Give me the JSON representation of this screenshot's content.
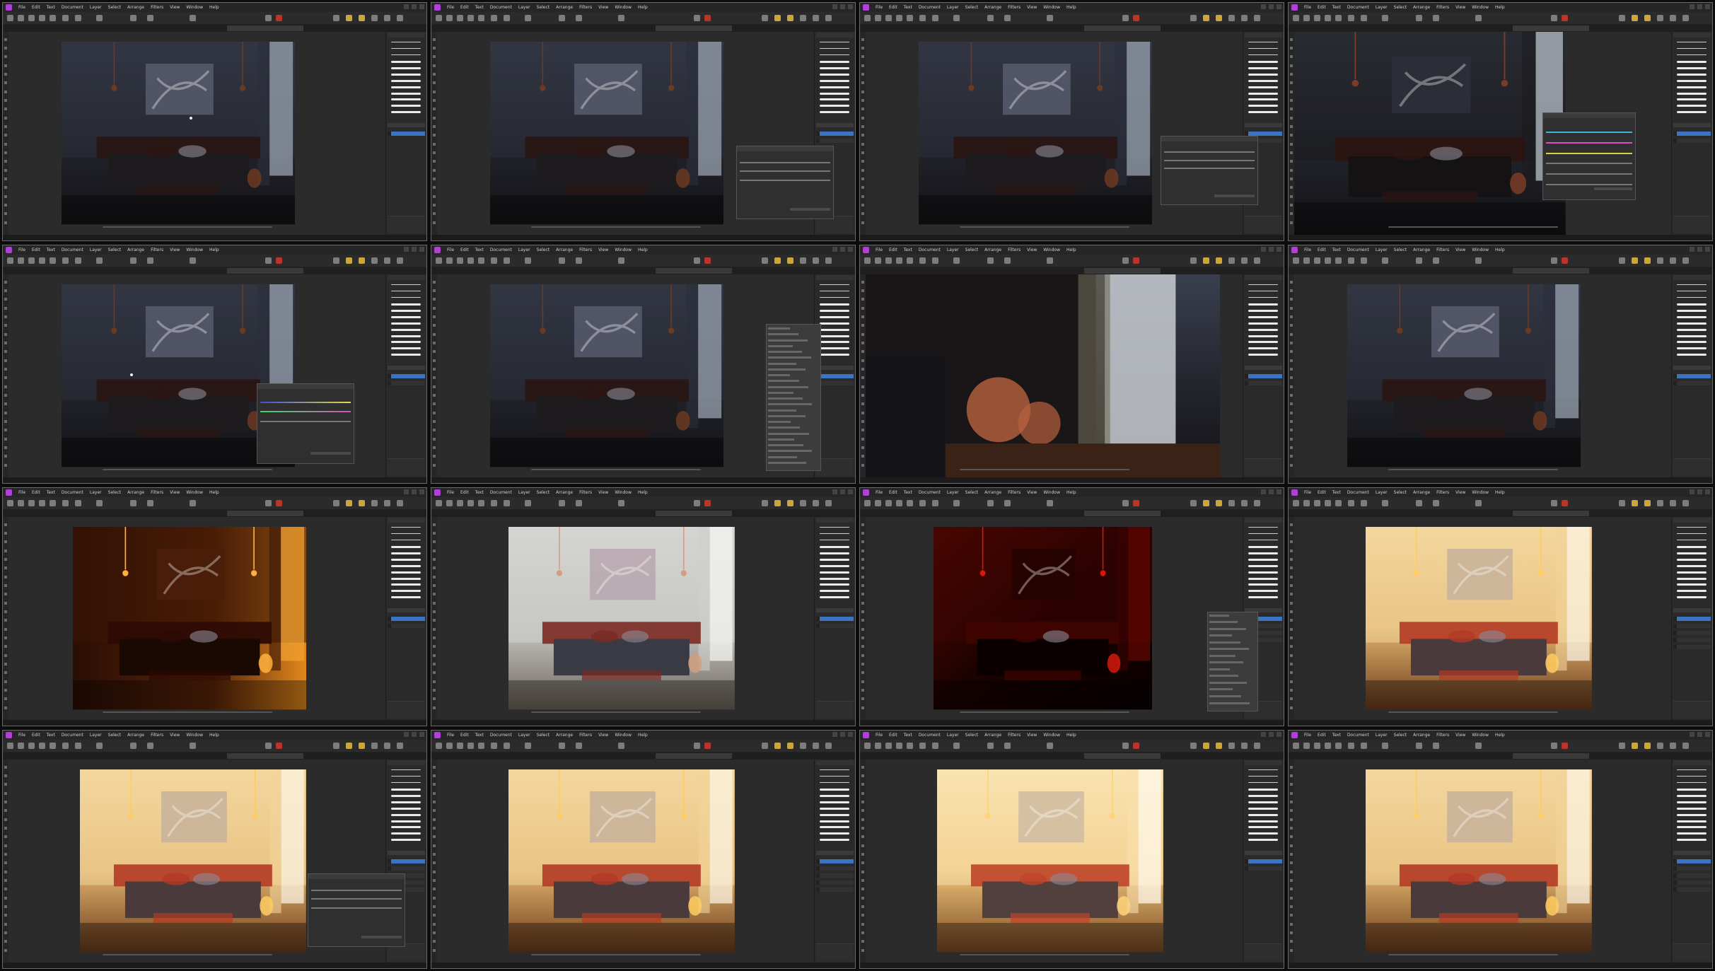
{
  "app": {
    "menu": [
      "File",
      "Edit",
      "Text",
      "Document",
      "Layer",
      "Select",
      "Arrange",
      "Filters",
      "View",
      "Window",
      "Help"
    ]
  },
  "colors": {
    "tile_bg": "#2e2e2e",
    "app_icon": "#b13fd8",
    "layer_selected": "#3d74c2",
    "brush_stroke": "#eaeaea"
  },
  "tiles": [
    {
      "scene": "night",
      "dialog": "none",
      "layers": 1
    },
    {
      "scene": "night",
      "dialog": "brightness-contrast",
      "layers": 2
    },
    {
      "scene": "night",
      "dialog": "levels",
      "layers": 2
    },
    {
      "scene": "night-zoom",
      "dialog": "selective-colour",
      "layers": 2
    },
    {
      "scene": "night",
      "dialog": "white-balance",
      "layers": 2
    },
    {
      "scene": "night",
      "dialog": "adjustment-menu",
      "layers": 2
    },
    {
      "scene": "night-closeup",
      "dialog": "none",
      "layers": 2
    },
    {
      "scene": "night",
      "dialog": "none",
      "layers": 2
    },
    {
      "scene": "amber-dark",
      "dialog": "none",
      "layers": 2
    },
    {
      "scene": "day",
      "dialog": "none",
      "layers": 2
    },
    {
      "scene": "red",
      "dialog": "blend-menu",
      "layers": 4
    },
    {
      "scene": "warm",
      "dialog": "none",
      "layers": 5
    },
    {
      "scene": "warm",
      "dialog": "brightness-contrast",
      "layers": 5
    },
    {
      "scene": "warm",
      "dialog": "none",
      "layers": 5
    },
    {
      "scene": "bright-warm",
      "dialog": "none",
      "layers": 2
    },
    {
      "scene": "warm",
      "dialog": "none",
      "layers": 5
    }
  ]
}
